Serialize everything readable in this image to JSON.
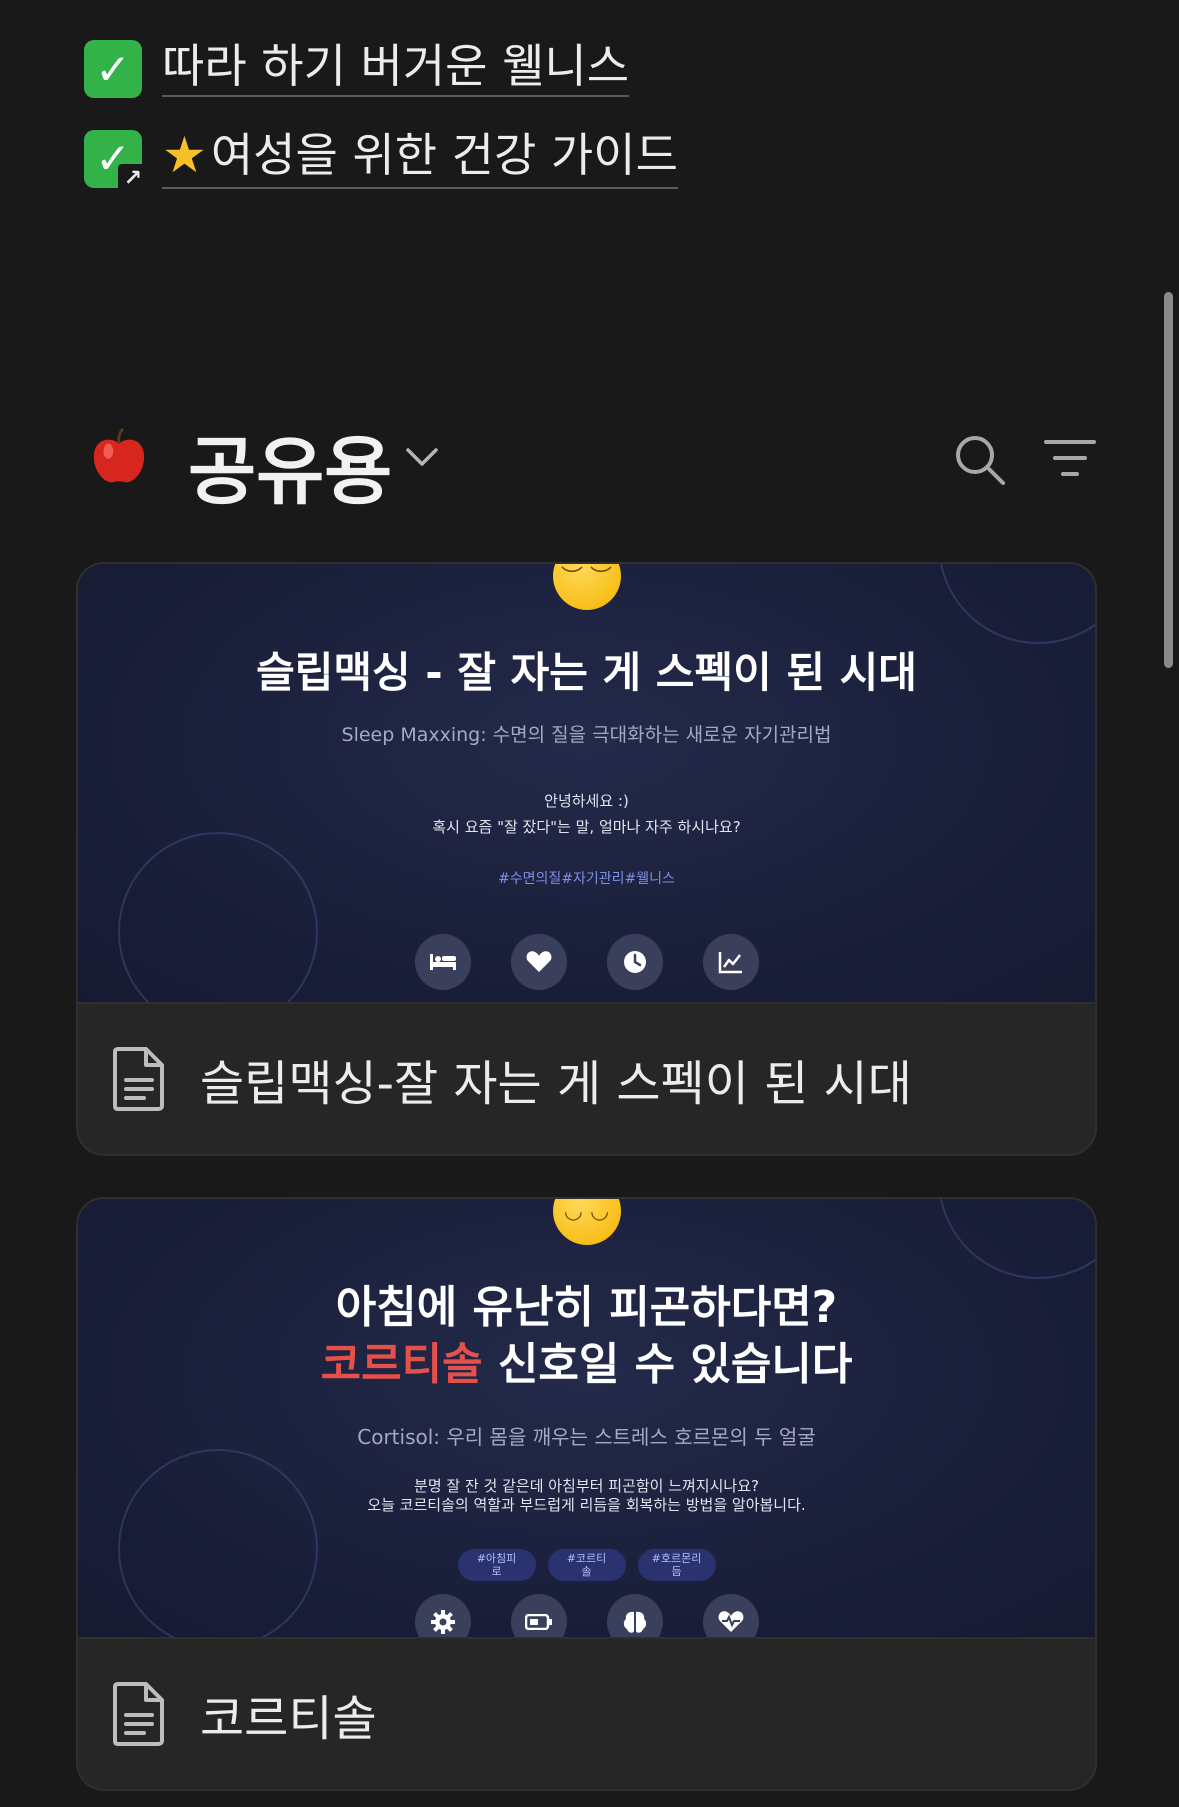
{
  "links": [
    {
      "text": "따라 하기 버거운 웰니스",
      "icon": "check-icon"
    },
    {
      "text": "여성을 위한 건강 가이드",
      "icon": "check-link-icon",
      "prefix_icon": "star-icon"
    }
  ],
  "database": {
    "emoji": "apple-icon",
    "title": "공유용"
  },
  "cards": [
    {
      "cover": {
        "emoji": "sleeping-face-icon",
        "title": "슬립맥싱 - 잘 자는 게 스펙이 된 시대",
        "subtitle": "Sleep Maxxing: 수면의 질을 극대화하는 새로운 자기관리법",
        "body_lines": [
          "안녕하세요 :)",
          "혹시 요즘 \"잘 잤다\"는 말, 얼마나 자주 하시나요?"
        ],
        "tags": "#수면의질#자기관리#웰니스",
        "icons": [
          "bed-icon",
          "heart-icon",
          "clock-icon",
          "chart-icon"
        ]
      },
      "title": "슬립맥싱-잘 자는 게 스펙이 된 시대"
    },
    {
      "cover": {
        "emoji": "yawning-face-icon",
        "title_line1": "아침에 유난히 피곤하다면?",
        "title_highlight": "코르티솔",
        "title_line2_rest": " 신호일 수 있습니다",
        "subtitle": "Cortisol: 우리 몸을 깨우는 스트레스 호르몬의 두 얼굴",
        "body_lines": [
          "분명 잘 잔 것 같은데 아침부터 피곤함이 느껴지시나요?",
          "오늘 코르티솔의 역할과 부드럽게 리듬을 회복하는 방법을 알아봅니다."
        ],
        "tag_pills": [
          [
            "#아침피",
            "로"
          ],
          [
            "#코르티",
            "솔"
          ],
          [
            "#호르몬리",
            "듬"
          ]
        ],
        "icons": [
          "gear-icon",
          "battery-icon",
          "brain-icon",
          "heartbeat-icon"
        ]
      },
      "title": "코르티솔"
    }
  ]
}
